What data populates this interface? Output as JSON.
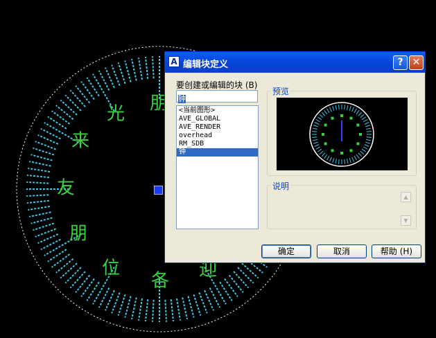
{
  "canvas": {
    "outer_chars": [
      "光",
      "朋",
      "来",
      "友",
      "朋",
      "位",
      "各",
      "迎"
    ],
    "colors": {
      "background": "#000000",
      "text": "#39d23f",
      "ticks": "#3ec8e8",
      "circle": "#ffffff"
    }
  },
  "dialog": {
    "title": "编辑块定义",
    "help_glyph": "?",
    "close_glyph": "✕",
    "block_name_label": "要创建或编辑的块 (B)",
    "block_name_value": "钟",
    "block_list": [
      "<当前图形>",
      "AVE_GLOBAL",
      "AVE_RENDER",
      "overhead",
      "RM_SDB",
      "钟"
    ],
    "selected_block": "钟",
    "preview_label": "预览",
    "description_label": "说明",
    "buttons": {
      "ok": "确定",
      "cancel": "取消",
      "help": "帮助 (H)"
    }
  }
}
